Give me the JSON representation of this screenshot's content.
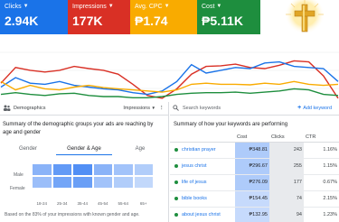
{
  "kpis": [
    {
      "label": "Clicks",
      "value": "2.94K"
    },
    {
      "label": "Impressions",
      "value": "177K"
    },
    {
      "label": "Avg. CPC",
      "value": "₱1.74"
    },
    {
      "label": "Cost",
      "value": "₱5.11K"
    }
  ],
  "colors": {
    "clicks": "#1a73e8",
    "impressions": "#d93025",
    "cpc": "#f9ab00",
    "cost": "#1e8e3e"
  },
  "chart_data": {
    "type": "line",
    "series": [
      {
        "values": [
          0.32,
          0.6,
          0.55,
          0.52,
          0.55,
          0.62,
          0.58,
          0.55,
          0.48,
          0.3,
          0.1,
          0.05,
          0.22,
          0.48,
          0.62,
          0.63,
          0.66,
          0.6,
          0.58,
          0.64,
          0.72,
          0.7,
          0.45,
          0.05
        ]
      },
      {
        "values": [
          0.25,
          0.42,
          0.32,
          0.3,
          0.35,
          0.28,
          0.25,
          0.22,
          0.2,
          0.15,
          0.12,
          0.18,
          0.35,
          0.65,
          0.5,
          0.55,
          0.6,
          0.58,
          0.68,
          0.7,
          0.62,
          0.6,
          0.58,
          0.35
        ]
      },
      {
        "values": [
          0.35,
          0.2,
          0.28,
          0.22,
          0.2,
          0.25,
          0.28,
          0.24,
          0.22,
          0.2,
          0.18,
          0.16,
          0.2,
          0.3,
          0.32,
          0.3,
          0.3,
          0.29,
          0.32,
          0.3,
          0.35,
          0.3,
          0.28,
          0.3
        ]
      },
      {
        "values": [
          0.12,
          0.15,
          0.12,
          0.1,
          0.13,
          0.14,
          0.1,
          0.08,
          0.08,
          0.06,
          0.06,
          0.08,
          0.12,
          0.14,
          0.15,
          0.15,
          0.16,
          0.14,
          0.16,
          0.18,
          0.22,
          0.2,
          0.12,
          0.1
        ]
      }
    ]
  },
  "demographics": {
    "header": "Demographics",
    "metric": "Impressions",
    "title": "Summary of the demographic groups your ads are reaching by age and gender",
    "tabs": [
      "Gender",
      "Gender & Age",
      "Age"
    ],
    "rows": [
      "Male",
      "Female"
    ],
    "ages": [
      "18-24",
      "25-34",
      "35-44",
      "45-54",
      "55-64",
      "65+"
    ],
    "heat": [
      [
        0.55,
        0.8,
        0.9,
        0.55,
        0.4,
        0.3
      ],
      [
        0.45,
        0.7,
        0.75,
        0.4,
        0.3,
        0.2
      ]
    ],
    "footnote": "Based on the 83% of your impressions with known gender and age."
  },
  "keywords": {
    "search_placeholder": "Search keywords",
    "add_label": "Add keyword",
    "title": "Summary of how your keywords are performing",
    "columns": [
      "Cost",
      "Clicks",
      "CTR"
    ],
    "rows": [
      {
        "name": "christian prayer",
        "cost": "₱348.81",
        "clicks": "243",
        "ctr": "1.16%"
      },
      {
        "name": "jesus christ",
        "cost": "₱296.67",
        "clicks": "255",
        "ctr": "1.15%"
      },
      {
        "name": "life of jesus",
        "cost": "₱276.09",
        "clicks": "177",
        "ctr": "0.67%"
      },
      {
        "name": "bible books",
        "cost": "₱154.45",
        "clicks": "74",
        "ctr": "2.15%"
      },
      {
        "name": "about jesus christ",
        "cost": "₱132.95",
        "clicks": "94",
        "ctr": "1.23%"
      }
    ]
  }
}
